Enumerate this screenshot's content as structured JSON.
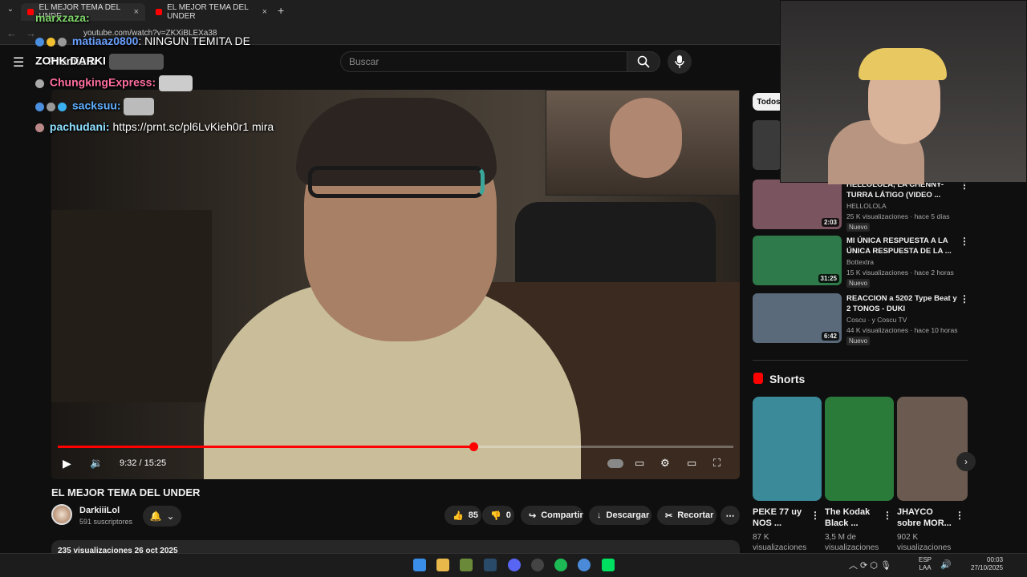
{
  "browser": {
    "tabs": [
      {
        "label": "EL MEJOR TEMA DEL UNDE"
      },
      {
        "label": "EL MEJOR TEMA DEL UNDER"
      }
    ],
    "url": "youtube.com/watch?v=ZKXiBLEXa38"
  },
  "youtube": {
    "logo": "Premium",
    "search_placeholder": "Buscar"
  },
  "overlay": {
    "streamer_name": "ZOHK DARKI",
    "chat": [
      {
        "user": "marxzaza:",
        "message": "",
        "color": "#7fd46a"
      },
      {
        "user": "matiaaz0800",
        "message": ": NINGUN TEMITA DE",
        "color": "#6aa0ff"
      },
      {
        "user": "ChungkingExpress:",
        "message": "",
        "color": "#ff6ea0"
      },
      {
        "user": "sacksuu:",
        "message": "",
        "color": "#5fb0ff"
      },
      {
        "user": "pachudani:",
        "message": " https://prnt.sc/pl6LvKieh0r1 mira",
        "color": "#8ee0ff"
      }
    ]
  },
  "player": {
    "time": "9:32 / 15:25",
    "progress": 0.6156
  },
  "video": {
    "title": "EL MEJOR TEMA DEL UNDER",
    "channel": "DarkiiiLol",
    "subscribers": "591 suscriptores",
    "likes": "85",
    "dislikes": "0",
    "share": "Compartir",
    "download": "Descargar",
    "clip": "Recortar",
    "meta": "235 visualizaciones 26 oct 2025"
  },
  "sidebar": {
    "chip": "Todos",
    "recommendations": [
      {
        "title": "HELLOLOLA, LA CHENNY-TURRA LÁTIGO (VIDEO ...",
        "channel": "HELLOLOLA",
        "meta": "25 K visualizaciones · hace 5 días",
        "duration": "2:03",
        "badge": "Nuevo",
        "thumb": "#7a5560"
      },
      {
        "title": "MI ÚNICA RESPUESTA A LA ÚNICA RESPUESTA DE LA ...",
        "channel": "Bottextra",
        "meta": "15 K visualizaciones · hace 2 horas",
        "duration": "31:25",
        "badge": "Nuevo",
        "thumb": "#2f7a4a"
      },
      {
        "title": "REACCION a 5202 Type Beat y 2 TONOS - DUKI",
        "channel": "Coscu · y Coscu TV",
        "meta": "44 K visualizaciones · hace 10 horas",
        "duration": "6:42",
        "badge": "Nuevo",
        "thumb": "#5a6a7a"
      }
    ],
    "shorts_heading": "Shorts",
    "shorts": [
      {
        "title": "PEKE 77 uy NOS ...",
        "meta": "87 K visualizaciones",
        "color": "#3b8a9a"
      },
      {
        "title": "The Kodak Black ...",
        "meta": "3,5 M de visualizaciones",
        "color": "#2a7a3a"
      },
      {
        "title": "JHAYCO sobre MOR...",
        "meta": "902 K visualizaciones",
        "color": "#6a5a50"
      }
    ]
  },
  "taskbar": {
    "lang": "ESP",
    "lang2": "LAA",
    "time": "00:03",
    "date": "27/10/2025"
  }
}
